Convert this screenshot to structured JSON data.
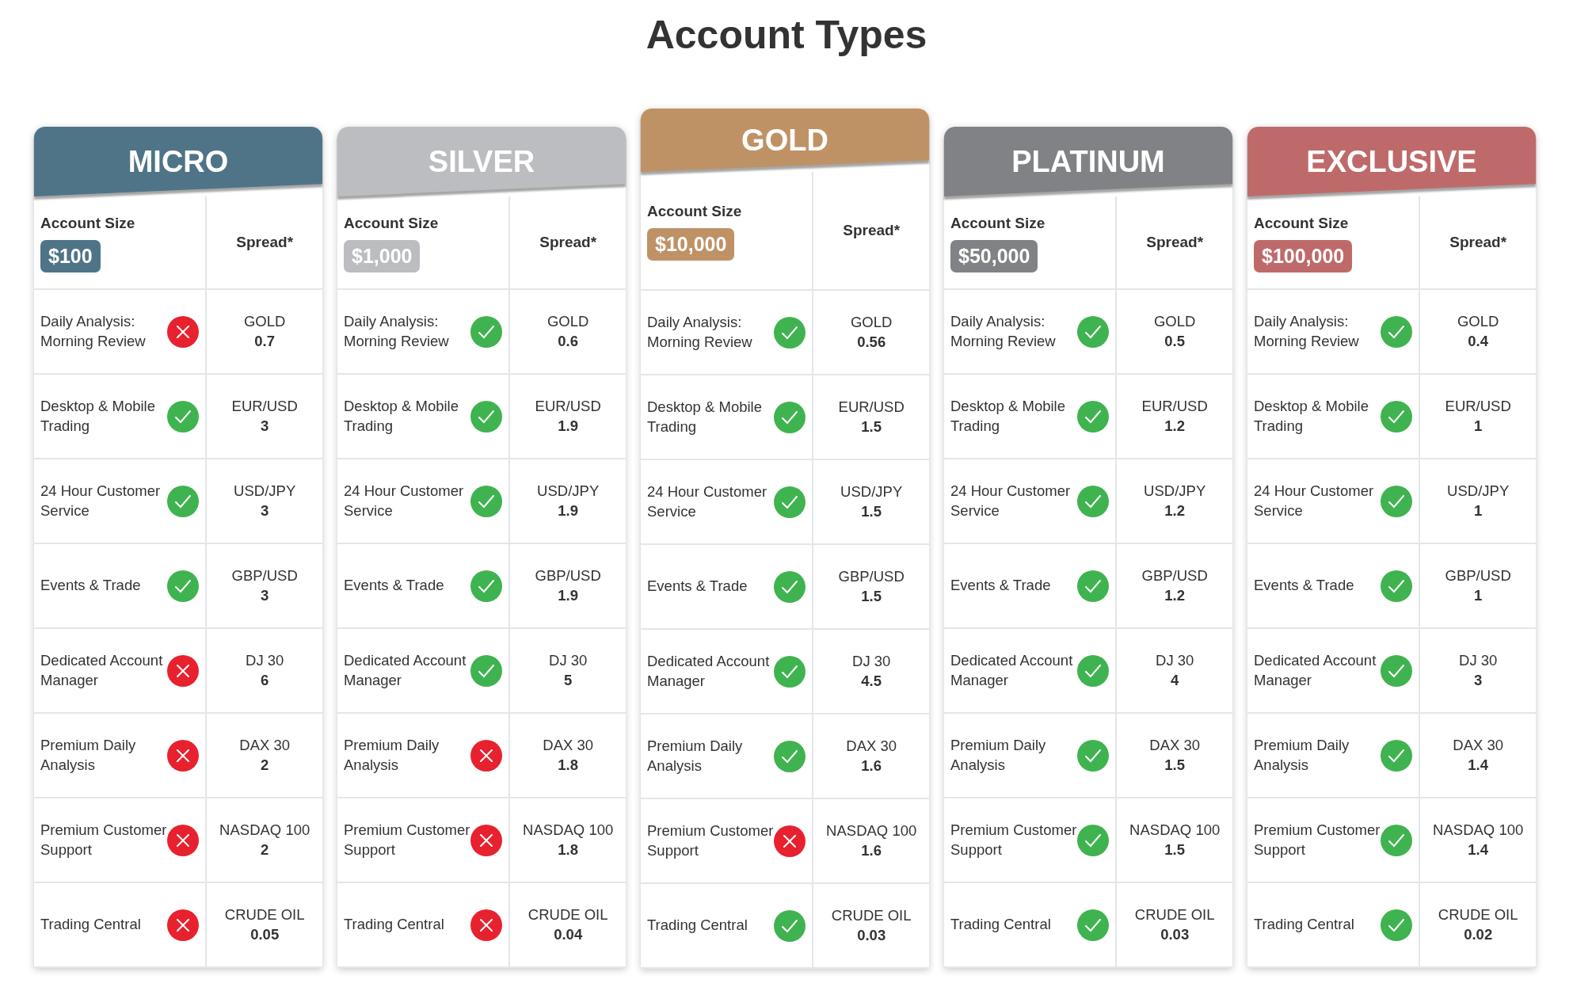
{
  "title": "Account Types",
  "plans": [
    {
      "name": "MICRO",
      "color": "#4f7488",
      "featured": false,
      "account_size_label": "Account Size",
      "size": "$100",
      "spread_label": "Spread*",
      "features": [
        {
          "label": "Daily Analysis: Morning Review",
          "included": false
        },
        {
          "label": "Desktop & Mobile Trading",
          "included": true
        },
        {
          "label": "24 Hour Customer Service",
          "included": true
        },
        {
          "label": "Events & Trade",
          "included": true
        },
        {
          "label": "Dedicated Account Manager",
          "included": false
        },
        {
          "label": "Premium Daily Analysis",
          "included": false
        },
        {
          "label": "Premium Customer Support",
          "included": false
        },
        {
          "label": "Trading Central",
          "included": false
        }
      ],
      "spreads": [
        {
          "instrument": "GOLD",
          "value": "0.7"
        },
        {
          "instrument": "EUR/USD",
          "value": "3"
        },
        {
          "instrument": "USD/JPY",
          "value": "3"
        },
        {
          "instrument": "GBP/USD",
          "value": "3"
        },
        {
          "instrument": "DJ 30",
          "value": "6"
        },
        {
          "instrument": "DAX 30",
          "value": "2"
        },
        {
          "instrument": "NASDAQ 100",
          "value": "2"
        },
        {
          "instrument": "CRUDE OIL",
          "value": "0.05"
        }
      ]
    },
    {
      "name": "SILVER",
      "color": "#bcbdc0",
      "featured": false,
      "account_size_label": "Account Size",
      "size": "$1,000",
      "spread_label": "Spread*",
      "features": [
        {
          "label": "Daily Analysis: Morning Review",
          "included": true
        },
        {
          "label": "Desktop & Mobile Trading",
          "included": true
        },
        {
          "label": "24 Hour Customer Service",
          "included": true
        },
        {
          "label": "Events & Trade",
          "included": true
        },
        {
          "label": "Dedicated Account Manager",
          "included": true
        },
        {
          "label": "Premium Daily Analysis",
          "included": false
        },
        {
          "label": "Premium Customer Support",
          "included": false
        },
        {
          "label": "Trading Central",
          "included": false
        }
      ],
      "spreads": [
        {
          "instrument": "GOLD",
          "value": "0.6"
        },
        {
          "instrument": "EUR/USD",
          "value": "1.9"
        },
        {
          "instrument": "USD/JPY",
          "value": "1.9"
        },
        {
          "instrument": "GBP/USD",
          "value": "1.9"
        },
        {
          "instrument": "DJ 30",
          "value": "5"
        },
        {
          "instrument": "DAX 30",
          "value": "1.8"
        },
        {
          "instrument": "NASDAQ 100",
          "value": "1.8"
        },
        {
          "instrument": "CRUDE OIL",
          "value": "0.04"
        }
      ]
    },
    {
      "name": "GOLD",
      "color": "#bf9266",
      "featured": true,
      "account_size_label": "Account Size",
      "size": "$10,000",
      "spread_label": "Spread*",
      "features": [
        {
          "label": "Daily Analysis: Morning Review",
          "included": true
        },
        {
          "label": "Desktop & Mobile Trading",
          "included": true
        },
        {
          "label": "24 Hour Customer Service",
          "included": true
        },
        {
          "label": "Events & Trade",
          "included": true
        },
        {
          "label": "Dedicated Account Manager",
          "included": true
        },
        {
          "label": "Premium Daily Analysis",
          "included": true
        },
        {
          "label": "Premium Customer Support",
          "included": false
        },
        {
          "label": "Trading Central",
          "included": true
        }
      ],
      "spreads": [
        {
          "instrument": "GOLD",
          "value": "0.56"
        },
        {
          "instrument": "EUR/USD",
          "value": "1.5"
        },
        {
          "instrument": "USD/JPY",
          "value": "1.5"
        },
        {
          "instrument": "GBP/USD",
          "value": "1.5"
        },
        {
          "instrument": "DJ 30",
          "value": "4.5"
        },
        {
          "instrument": "DAX 30",
          "value": "1.6"
        },
        {
          "instrument": "NASDAQ 100",
          "value": "1.6"
        },
        {
          "instrument": "CRUDE OIL",
          "value": "0.03"
        }
      ]
    },
    {
      "name": "PLATINUM",
      "color": "#818285",
      "featured": false,
      "account_size_label": "Account Size",
      "size": "$50,000",
      "spread_label": "Spread*",
      "features": [
        {
          "label": "Daily Analysis: Morning Review",
          "included": true
        },
        {
          "label": "Desktop & Mobile Trading",
          "included": true
        },
        {
          "label": "24 Hour Customer Service",
          "included": true
        },
        {
          "label": "Events & Trade",
          "included": true
        },
        {
          "label": "Dedicated Account Manager",
          "included": true
        },
        {
          "label": "Premium Daily Analysis",
          "included": true
        },
        {
          "label": "Premium Customer Support",
          "included": true
        },
        {
          "label": "Trading Central",
          "included": true
        }
      ],
      "spreads": [
        {
          "instrument": "GOLD",
          "value": "0.5"
        },
        {
          "instrument": "EUR/USD",
          "value": "1.2"
        },
        {
          "instrument": "USD/JPY",
          "value": "1.2"
        },
        {
          "instrument": "GBP/USD",
          "value": "1.2"
        },
        {
          "instrument": "DJ 30",
          "value": "4"
        },
        {
          "instrument": "DAX 30",
          "value": "1.5"
        },
        {
          "instrument": "NASDAQ 100",
          "value": "1.5"
        },
        {
          "instrument": "CRUDE OIL",
          "value": "0.03"
        }
      ]
    },
    {
      "name": "EXCLUSIVE",
      "color": "#bf6a6a",
      "featured": false,
      "account_size_label": "Account Size",
      "size": "$100,000",
      "spread_label": "Spread*",
      "features": [
        {
          "label": "Daily Analysis: Morning Review",
          "included": true
        },
        {
          "label": "Desktop & Mobile Trading",
          "included": true
        },
        {
          "label": "24 Hour Customer Service",
          "included": true
        },
        {
          "label": "Events & Trade",
          "included": true
        },
        {
          "label": "Dedicated Account Manager",
          "included": true
        },
        {
          "label": "Premium Daily Analysis",
          "included": true
        },
        {
          "label": "Premium Customer Support",
          "included": true
        },
        {
          "label": "Trading Central",
          "included": true
        }
      ],
      "spreads": [
        {
          "instrument": "GOLD",
          "value": "0.4"
        },
        {
          "instrument": "EUR/USD",
          "value": "1"
        },
        {
          "instrument": "USD/JPY",
          "value": "1"
        },
        {
          "instrument": "GBP/USD",
          "value": "1"
        },
        {
          "instrument": "DJ 30",
          "value": "3"
        },
        {
          "instrument": "DAX 30",
          "value": "1.4"
        },
        {
          "instrument": "NASDAQ 100",
          "value": "1.4"
        },
        {
          "instrument": "CRUDE OIL",
          "value": "0.02"
        }
      ]
    }
  ]
}
